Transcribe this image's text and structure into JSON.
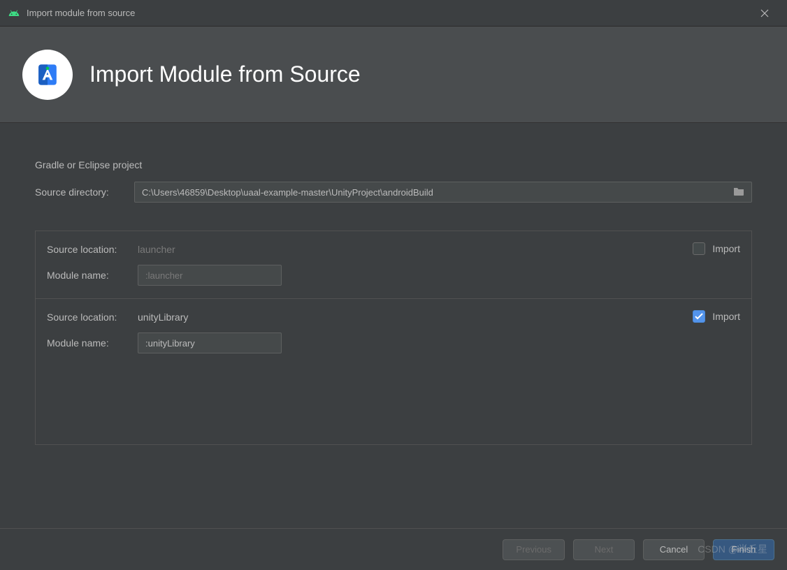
{
  "titlebar": {
    "title": "Import module from source"
  },
  "header": {
    "title": "Import Module from Source"
  },
  "form": {
    "section_label": "Gradle or Eclipse project",
    "source_dir_label": "Source directory:",
    "source_dir_value": "C:\\Users\\46859\\Desktop\\uaal-example-master\\UnityProject\\androidBuild"
  },
  "modules": [
    {
      "source_location_label": "Source location:",
      "source_location_value": "launcher",
      "module_name_label": "Module name:",
      "module_name_value": ":launcher",
      "import_label": "Import",
      "checked": false
    },
    {
      "source_location_label": "Source location:",
      "source_location_value": "unityLibrary",
      "module_name_label": "Module name:",
      "module_name_value": ":unityLibrary",
      "import_label": "Import",
      "checked": true
    }
  ],
  "footer": {
    "previous": "Previous",
    "next": "Next",
    "cancel": "Cancel",
    "finish": "Finish"
  },
  "watermark": "CSDN @半丘星"
}
